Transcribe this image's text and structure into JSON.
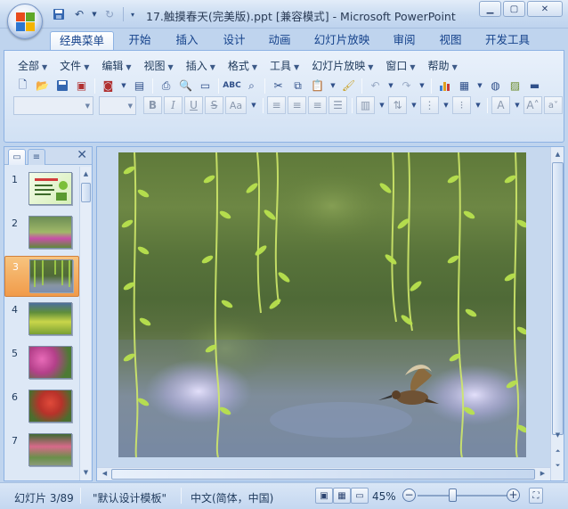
{
  "window": {
    "title": "17.触摸春天(完美版).ppt [兼容模式] - Microsoft PowerPoint"
  },
  "quick_access": {
    "icons": [
      "save-icon",
      "undo-icon",
      "redo-icon",
      "customize-icon"
    ]
  },
  "ribbon_tabs": [
    {
      "label": "经典菜单",
      "active": true
    },
    {
      "label": "开始"
    },
    {
      "label": "插入"
    },
    {
      "label": "设计"
    },
    {
      "label": "动画"
    },
    {
      "label": "幻灯片放映"
    },
    {
      "label": "审阅"
    },
    {
      "label": "视图"
    },
    {
      "label": "开发工具"
    }
  ],
  "classic_menu": [
    {
      "label": "全部"
    },
    {
      "label": "文件"
    },
    {
      "label": "编辑"
    },
    {
      "label": "视图"
    },
    {
      "label": "插入"
    },
    {
      "label": "格式"
    },
    {
      "label": "工具"
    },
    {
      "label": "幻灯片放映"
    },
    {
      "label": "窗口"
    },
    {
      "label": "帮助"
    }
  ],
  "format_buttons": {
    "bold": "B",
    "italic": "I",
    "underline": "U",
    "strike": "S",
    "case": "Aa"
  },
  "left_panel": {
    "tabs": [
      "slides-tab",
      "outline-tab"
    ],
    "slides": [
      {
        "number": "1"
      },
      {
        "number": "2"
      },
      {
        "number": "3",
        "selected": true
      },
      {
        "number": "4"
      },
      {
        "number": "5"
      },
      {
        "number": "6"
      },
      {
        "number": "7"
      }
    ]
  },
  "status": {
    "slide_counter": "幻灯片 3/89",
    "theme": "\"默认设计模板\"",
    "language": "中文(简体，中国)",
    "zoom": "45%",
    "zoom_fraction": 0.38
  },
  "colors": {
    "accent": "#15428b",
    "ribbon_bg": "#dbe7f6",
    "selected_slide": "#f19b4a"
  }
}
